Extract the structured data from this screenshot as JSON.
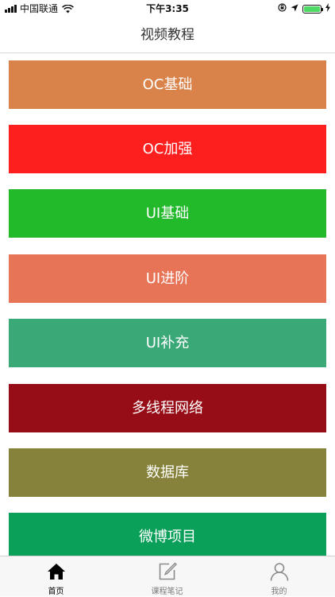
{
  "status_bar": {
    "carrier": "中国联通",
    "time": "下午3:35",
    "battery_color": "#4cd964"
  },
  "nav": {
    "title": "视频教程"
  },
  "courses": [
    {
      "label": "OC基础",
      "color": "#d9824a"
    },
    {
      "label": "OC加强",
      "color": "#fd1e1e"
    },
    {
      "label": "UI基础",
      "color": "#22b92b"
    },
    {
      "label": "UI进阶",
      "color": "#e87458"
    },
    {
      "label": "UI补充",
      "color": "#3aa977"
    },
    {
      "label": "多线程网络",
      "color": "#970d17"
    },
    {
      "label": "数据库",
      "color": "#87823b"
    },
    {
      "label": "微博项目",
      "color": "#0aa05a"
    }
  ],
  "tabbar": {
    "home": {
      "label": "首页",
      "icon": "home-icon",
      "color": "#000000"
    },
    "notes": {
      "label": "课程笔记",
      "icon": "edit-icon",
      "color": "#7a7a7a"
    },
    "mine": {
      "label": "我的",
      "icon": "person-icon",
      "color": "#7a7a7a"
    }
  }
}
